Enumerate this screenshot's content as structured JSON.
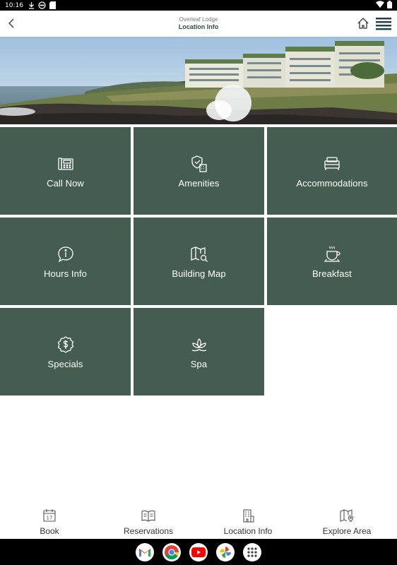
{
  "status_bar": {
    "time": "10:16",
    "icons": [
      "download-icon",
      "vpn-icon",
      "sd-card-icon",
      "wifi-icon",
      "battery-icon"
    ]
  },
  "header": {
    "subtitle": "Overleaf Lodge",
    "title": "Location Info"
  },
  "tiles": [
    {
      "label": "Call Now",
      "icon": "phone-icon"
    },
    {
      "label": "Amenities",
      "icon": "amenities-icon"
    },
    {
      "label": "Accommodations",
      "icon": "bed-icon"
    },
    {
      "label": "Hours Info",
      "icon": "info-icon"
    },
    {
      "label": "Building Map",
      "icon": "map-search-icon"
    },
    {
      "label": "Breakfast",
      "icon": "coffee-icon"
    },
    {
      "label": "Specials",
      "icon": "dollar-badge-icon"
    },
    {
      "label": "Spa",
      "icon": "lotus-icon"
    }
  ],
  "bottom_nav": [
    {
      "label": "Book",
      "icon": "calendar-icon",
      "calendar_day": "17"
    },
    {
      "label": "Reservations",
      "icon": "book-icon"
    },
    {
      "label": "Location Info",
      "icon": "building-icon"
    },
    {
      "label": "Explore Area",
      "icon": "map-pin-icon"
    }
  ],
  "dock_apps": [
    "gmail-icon",
    "chrome-icon",
    "youtube-icon",
    "photos-icon",
    "app-drawer-icon"
  ],
  "colors": {
    "tile": "#445d50",
    "header_title": "#2f4d3f",
    "accent": "#1f3d4e"
  }
}
